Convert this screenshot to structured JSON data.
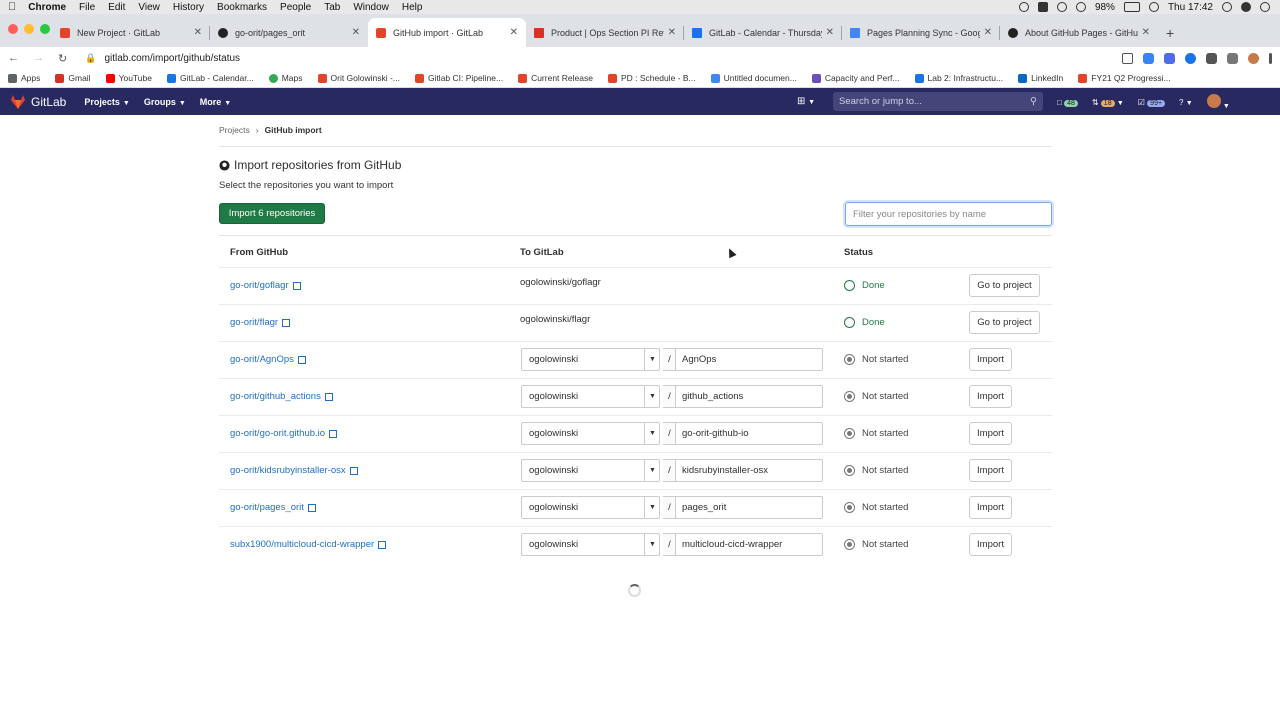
{
  "mac_menu": {
    "app": "Chrome",
    "items": [
      "File",
      "Edit",
      "View",
      "History",
      "Bookmarks",
      "People",
      "Tab",
      "Window",
      "Help"
    ],
    "battery": "98%",
    "clock": "Thu 17:42"
  },
  "tabs": [
    {
      "title": "New Project · GitLab",
      "icon": "gitlab-icon",
      "color": "#e2432a"
    },
    {
      "title": "go-orit/pages_orit",
      "icon": "github-icon",
      "color": "#222222"
    },
    {
      "title": "GitHub import · GitLab",
      "icon": "gitlab-icon",
      "color": "#e2432a"
    },
    {
      "title": "Product | Ops Section PI Revie",
      "icon": "gmail-icon",
      "color": "#d93025"
    },
    {
      "title": "GitLab - Calendar - Thursday,",
      "icon": "calendar-icon",
      "color": "#1a73e8"
    },
    {
      "title": "Pages Planning Sync - Google",
      "icon": "docs-icon",
      "color": "#4285f4"
    },
    {
      "title": "About GitHub Pages - GitHub I",
      "icon": "github-icon",
      "color": "#222222"
    }
  ],
  "omnibox": {
    "url": "gitlab.com/import/github/status"
  },
  "bookmarks": [
    {
      "label": "Apps",
      "color": "#5f6368"
    },
    {
      "label": "Gmail",
      "color": "#d93025"
    },
    {
      "label": "YouTube",
      "color": "#ff0000"
    },
    {
      "label": "GitLab - Calendar...",
      "color": "#1a73e8"
    },
    {
      "label": "Maps",
      "color": "#34a853"
    },
    {
      "label": "Orit Golowinski -...",
      "color": "#e2432a"
    },
    {
      "label": "Gitlab CI: Pipeline...",
      "color": "#e2432a"
    },
    {
      "label": "Current Release",
      "color": "#e2432a"
    },
    {
      "label": "PD : Schedule - B...",
      "color": "#e2432a"
    },
    {
      "label": "Untitled documen...",
      "color": "#4285f4"
    },
    {
      "label": "Capacity and Perf...",
      "color": "#6b4fbb"
    },
    {
      "label": "Lab 2: Infrastructu...",
      "color": "#1a73e8"
    },
    {
      "label": "LinkedIn",
      "color": "#0a66c2"
    },
    {
      "label": "FY21 Q2 Progressi...",
      "color": "#e2432a"
    }
  ],
  "gitlab_nav": {
    "brand": "GitLab",
    "items": [
      "Projects",
      "Groups",
      "More"
    ],
    "search_placeholder": "Search or jump to...",
    "issues_count": "48",
    "mr_count": "18",
    "todo_count": "99+"
  },
  "breadcrumb": {
    "parent": "Projects",
    "current": "GitHub import"
  },
  "page": {
    "title": "Import repositories from GitHub",
    "subtitle": "Select the repositories you want to import",
    "import_all_label": "Import 6 repositories",
    "filter_placeholder": "Filter your repositories by name"
  },
  "table": {
    "headers": {
      "from": "From GitHub",
      "to": "To GitLab",
      "status": "Status"
    },
    "rows": [
      {
        "source": "go-orit/goflagr",
        "target": "ogolowinski/goflagr",
        "status": "Done",
        "action": "Go to project"
      },
      {
        "source": "go-orit/flagr",
        "target": "ogolowinski/flagr",
        "status": "Done",
        "action": "Go to project"
      },
      {
        "source": "go-orit/AgnOps",
        "namespace": "ogolowinski",
        "slash": "/",
        "name": "AgnOps",
        "status": "Not started",
        "action": "Import"
      },
      {
        "source": "go-orit/github_actions",
        "namespace": "ogolowinski",
        "slash": "/",
        "name": "github_actions",
        "status": "Not started",
        "action": "Import"
      },
      {
        "source": "go-orit/go-orit.github.io",
        "namespace": "ogolowinski",
        "slash": "/",
        "name": "go-orit-github-io",
        "status": "Not started",
        "action": "Import"
      },
      {
        "source": "go-orit/kidsrubyinstaller-osx",
        "namespace": "ogolowinski",
        "slash": "/",
        "name": "kidsrubyinstaller-osx",
        "status": "Not started",
        "action": "Import"
      },
      {
        "source": "go-orit/pages_orit",
        "namespace": "ogolowinski",
        "slash": "/",
        "name": "pages_orit",
        "status": "Not started",
        "action": "Import"
      },
      {
        "source": "subx1900/multicloud-cicd-wrapper",
        "namespace": "ogolowinski",
        "slash": "/",
        "name": "multicloud-cicd-wrapper",
        "status": "Not started",
        "action": "Import"
      }
    ]
  },
  "colors": {
    "gitlab_nav": "#292961",
    "primary_button": "#1f7a45",
    "link": "#1f6fc5",
    "success": "#1f7a45"
  }
}
